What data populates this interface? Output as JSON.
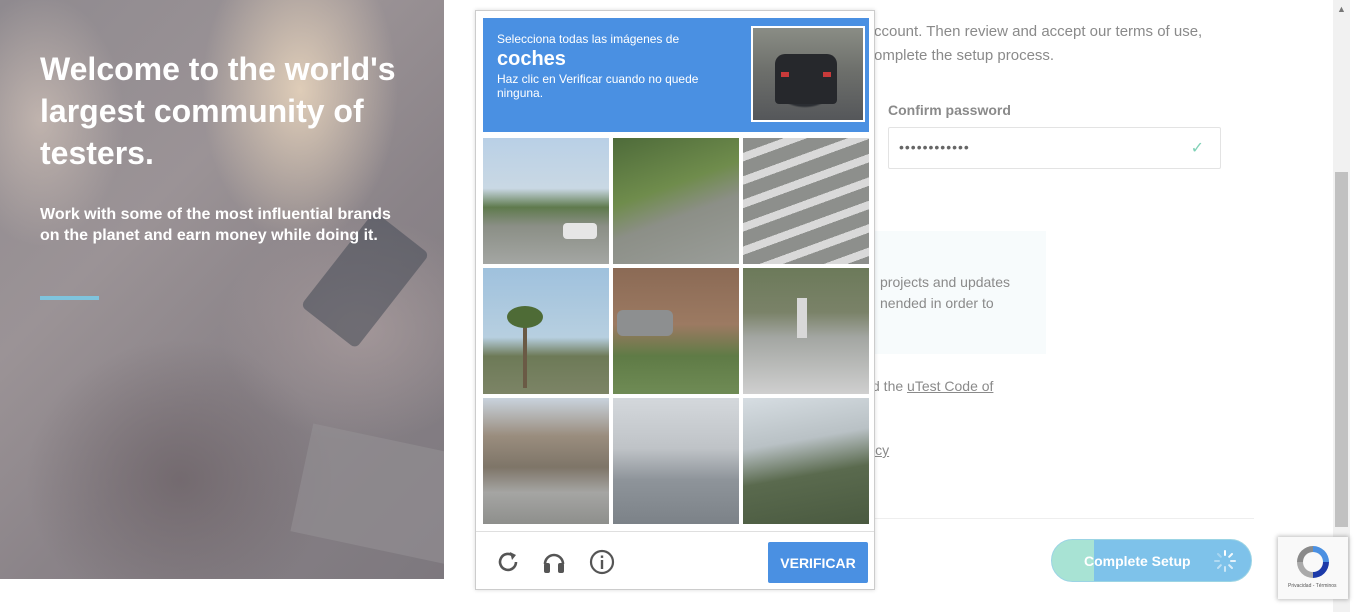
{
  "hero": {
    "title": "Welcome to the world's largest community of testers.",
    "subtitle": "Work with some of the most influential brands on the planet and earn money while doing it."
  },
  "form": {
    "intro_text": "ccount. Then review and accept our terms of use, omplete the setup process.",
    "confirm_password_label": "Confirm password",
    "confirm_password_value": "••••••••••••",
    "info_text": "projects and updates nended in order to",
    "agree_prefix": "d the ",
    "agree_link": "uTest Code of",
    "policy_fragment": "icy",
    "complete_button_label": "Complete Setup"
  },
  "captcha": {
    "instruction_line1": "Selecciona todas las imágenes de",
    "target_word": "coches",
    "instruction_line2": "Haz clic en Verificar cuando no quede ninguna.",
    "verify_button_label": "VERIFICAR",
    "tiles": [
      {
        "name": "tile-street-intersection"
      },
      {
        "name": "tile-grass-road"
      },
      {
        "name": "tile-crosswalk"
      },
      {
        "name": "tile-palm-trees-sky"
      },
      {
        "name": "tile-parked-car-house"
      },
      {
        "name": "tile-pedestrian-crosswalk"
      },
      {
        "name": "tile-road-buildings"
      },
      {
        "name": "tile-rooftops"
      },
      {
        "name": "tile-palm-fronds"
      }
    ]
  },
  "recaptcha_badge": {
    "text": "Privacidad - Términos"
  },
  "colors": {
    "captcha_blue": "#4a90e2",
    "accent_bar": "#7fc4dd",
    "button_teal": "#a8e3d4",
    "button_blue": "#7ec2ea",
    "check_green": "#7fd1b6"
  }
}
